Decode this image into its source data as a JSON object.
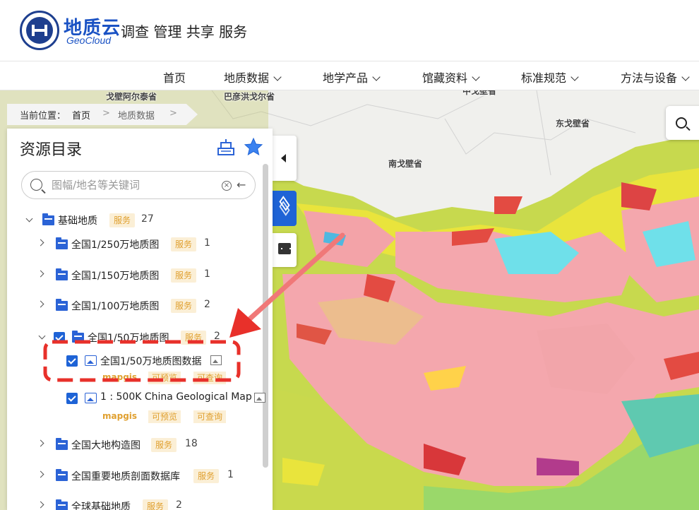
{
  "header": {
    "brand_cn": "地质云",
    "brand_en": "GeoCloud",
    "slogan": "调查 管理 共享 服务"
  },
  "nav": {
    "items": [
      {
        "label": "首页",
        "dropdown": false
      },
      {
        "label": "地质数据",
        "dropdown": true
      },
      {
        "label": "地学产品",
        "dropdown": true
      },
      {
        "label": "馆藏资料",
        "dropdown": true
      },
      {
        "label": "标准规范",
        "dropdown": true
      },
      {
        "label": "方法与设备",
        "dropdown": true
      }
    ]
  },
  "breadcrumb": {
    "prefix": "当前位置：",
    "home": "首页",
    "sep": ">",
    "current": "地质数据"
  },
  "map": {
    "labels": [
      "戈壁阿尔泰省",
      "巴彦洪戈尔省",
      "中戈壁省",
      "东戈壁省",
      "南戈壁省"
    ]
  },
  "panel": {
    "title": "资源目录",
    "search_placeholder": "图幅/地名等关键词",
    "tree": [
      {
        "label": "基础地质",
        "badge": "服务",
        "count": "27",
        "level": 0,
        "expanded": true
      },
      {
        "label": "全国1/250万地质图",
        "badge": "服务",
        "count": "1",
        "level": 1
      },
      {
        "label": "全国1/150万地质图",
        "badge": "服务",
        "count": "1",
        "level": 1
      },
      {
        "label": "全国1/100万地质图",
        "badge": "服务",
        "count": "2",
        "level": 1
      },
      {
        "label": "全国1/50万地质图",
        "badge": "服务",
        "count": "2",
        "level": 1,
        "expanded": true,
        "checked": true
      },
      {
        "label": "全国1/50万地质图数据",
        "level": 2,
        "checked": true,
        "tags": [
          "mapgis",
          "可预览",
          "可查询"
        ]
      },
      {
        "label": "1 : 500K China Geological Map",
        "level": 2,
        "checked": true,
        "tags": [
          "mapgis",
          "可预览",
          "可查询"
        ]
      },
      {
        "label": "全国大地构造图",
        "badge": "服务",
        "count": "18",
        "level": 1
      },
      {
        "label": "全国重要地质剖面数据库",
        "badge": "服务",
        "count": "1",
        "level": 1
      },
      {
        "label": "全球基础地质",
        "badge": "服务",
        "count": "2",
        "level": 1
      }
    ]
  },
  "colors": {
    "brand": "#1a52c4",
    "accent_blue": "#1e63d6",
    "badge_bg": "#fbefd6",
    "badge_text": "#e0a030",
    "annotation_red": "#e8302a"
  },
  "icons": {
    "panel_header": [
      "sql-database-icon",
      "star-icon"
    ],
    "map_tools": [
      "collapse-arrow-icon",
      "layers-icon",
      "legend-icon",
      "search-icon"
    ]
  }
}
